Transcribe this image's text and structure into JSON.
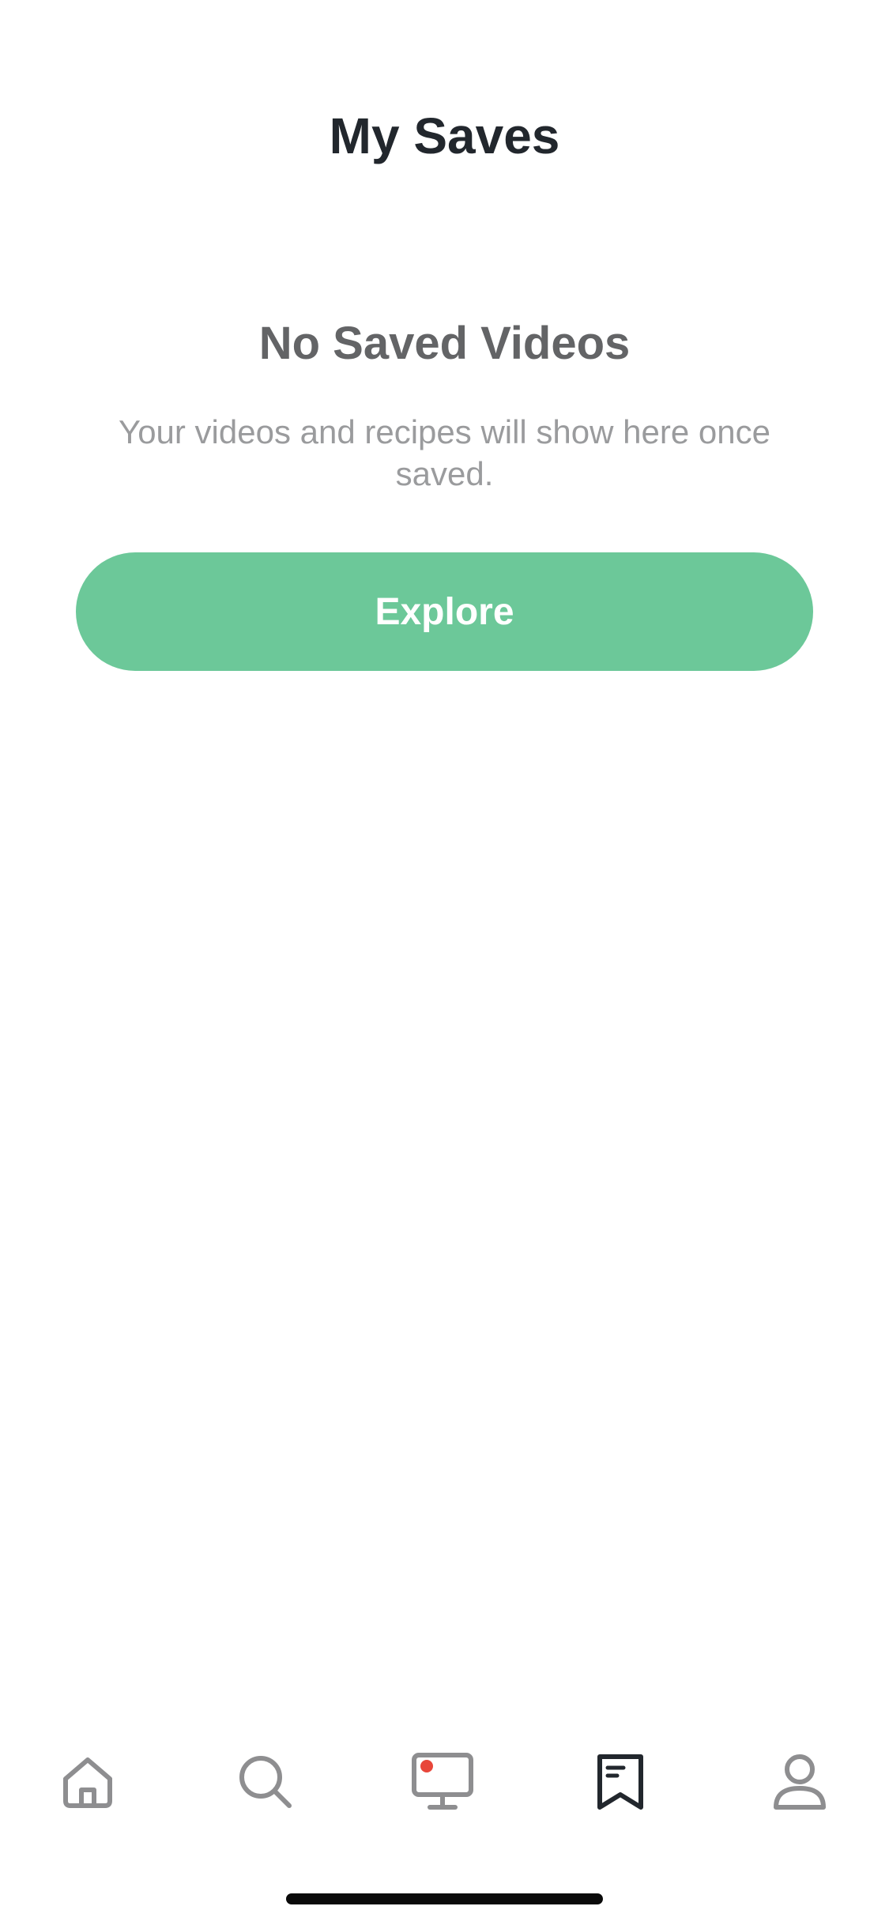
{
  "header": {
    "title": "My Saves"
  },
  "empty_state": {
    "title": "No Saved Videos",
    "message": "Your videos and recipes will show here once saved.",
    "button_label": "Explore"
  },
  "colors": {
    "accent": "#6cc899",
    "live_dot": "#e8463a",
    "tab_inactive": "#8e8e90",
    "tab_active": "#22272d"
  },
  "tab_bar": {
    "items": [
      {
        "icon": "home-icon",
        "active": false
      },
      {
        "icon": "search-icon",
        "active": false
      },
      {
        "icon": "live-tv-icon",
        "active": false
      },
      {
        "icon": "bookmark-icon",
        "active": true
      },
      {
        "icon": "profile-icon",
        "active": false
      }
    ]
  }
}
